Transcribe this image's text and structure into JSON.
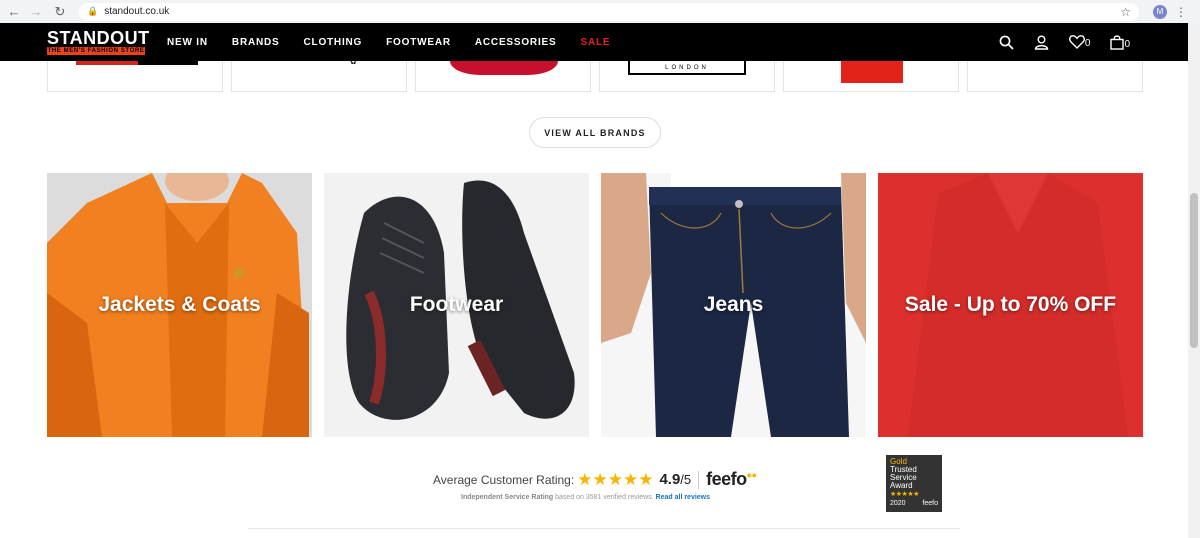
{
  "browser": {
    "url": "standout.co.uk",
    "profile_initial": "M"
  },
  "header": {
    "logo_main": "STANDOUT",
    "logo_sub": "THE MEN'S FASHION STORE",
    "nav": [
      "NEW IN",
      "BRANDS",
      "CLOTHING",
      "FOOTWEAR",
      "ACCESSORIES",
      "SALE"
    ],
    "wishlist_count": "0",
    "cart_count": "0"
  },
  "brands": {
    "london_logo_text": "LONDON",
    "view_all_label": "VIEW ALL BRANDS"
  },
  "categories": [
    {
      "label": "Jackets & Coats",
      "color": "#f07a1a"
    },
    {
      "label": "Footwear",
      "color": "#2b2d33"
    },
    {
      "label": "Jeans",
      "color": "#1c2744"
    },
    {
      "label": "Sale - Up to 70% OFF",
      "color": "#e0312f"
    }
  ],
  "rating": {
    "prefix": "Average Customer Rating:",
    "score": "4.9",
    "score_max": "/5",
    "provider": "feefo",
    "sub_bold": "Independent Service Rating",
    "sub_text": "based on 3581 verified reviews.",
    "link_text": "Read all reviews"
  },
  "award": {
    "line1": "Gold",
    "line2": "Trusted",
    "line3": "Service",
    "line4": "Award",
    "year": "2020",
    "brand": "feefo"
  },
  "colors": {
    "sale_red": "#e32219",
    "logo_orange": "#e8441c",
    "star_gold": "#f7b500"
  }
}
